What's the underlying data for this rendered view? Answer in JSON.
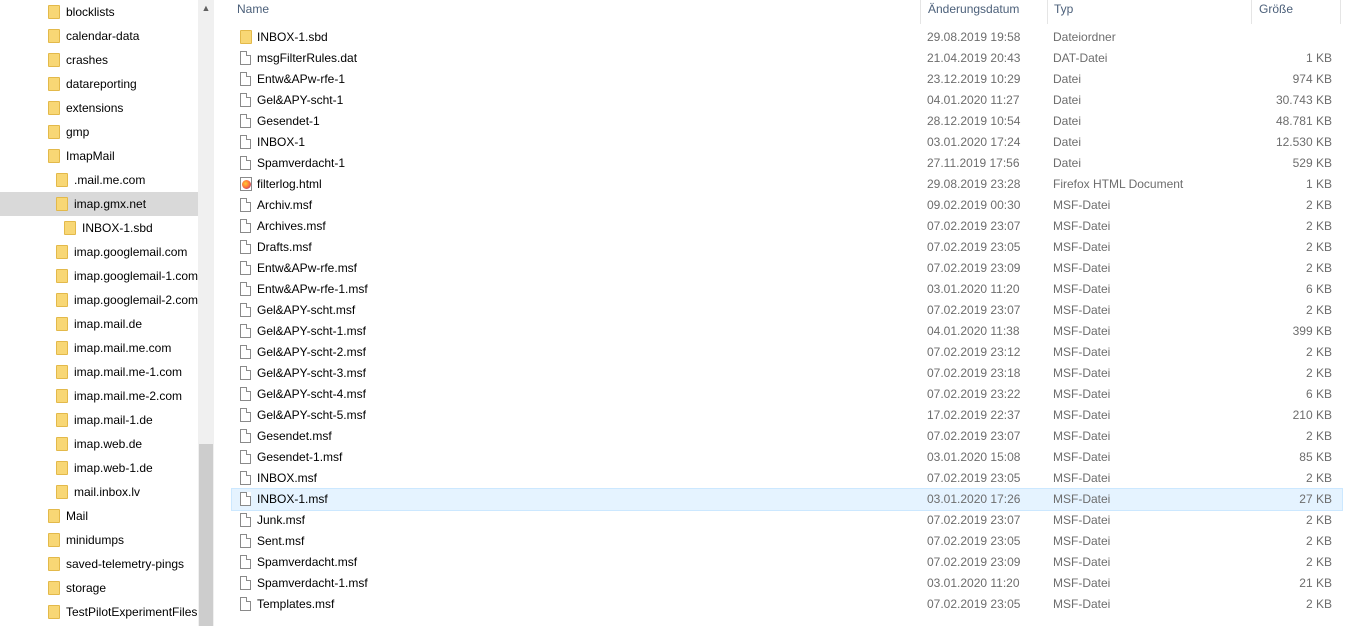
{
  "nav": {
    "items": [
      {
        "label": "blocklists",
        "level": 0
      },
      {
        "label": "calendar-data",
        "level": 0
      },
      {
        "label": "crashes",
        "level": 0
      },
      {
        "label": "datareporting",
        "level": 0
      },
      {
        "label": "extensions",
        "level": 0
      },
      {
        "label": "gmp",
        "level": 0
      },
      {
        "label": "ImapMail",
        "level": 0
      },
      {
        "label": ".mail.me.com",
        "level": 1
      },
      {
        "label": "imap.gmx.net",
        "level": 1,
        "selected": true
      },
      {
        "label": "INBOX-1.sbd",
        "level": 2
      },
      {
        "label": "imap.googlemail.com",
        "level": 1
      },
      {
        "label": "imap.googlemail-1.com",
        "level": 1
      },
      {
        "label": "imap.googlemail-2.com",
        "level": 1
      },
      {
        "label": "imap.mail.de",
        "level": 1
      },
      {
        "label": "imap.mail.me.com",
        "level": 1
      },
      {
        "label": "imap.mail.me-1.com",
        "level": 1
      },
      {
        "label": "imap.mail.me-2.com",
        "level": 1
      },
      {
        "label": "imap.mail-1.de",
        "level": 1
      },
      {
        "label": "imap.web.de",
        "level": 1
      },
      {
        "label": "imap.web-1.de",
        "level": 1
      },
      {
        "label": "mail.inbox.lv",
        "level": 1
      },
      {
        "label": "Mail",
        "level": 0
      },
      {
        "label": "minidumps",
        "level": 0
      },
      {
        "label": "saved-telemetry-pings",
        "level": 0
      },
      {
        "label": "storage",
        "level": 0
      },
      {
        "label": "TestPilotExperimentFiles",
        "level": 0
      }
    ],
    "scroll_up_icon": "chevron-up-icon"
  },
  "list": {
    "columns": {
      "name": "Name",
      "date": "Änderungsdatum",
      "type": "Typ",
      "size": "Größe"
    },
    "rows": [
      {
        "name": "INBOX-1.sbd",
        "date": "29.08.2019 19:58",
        "type": "Dateiordner",
        "size": "",
        "icon": "folder-icon"
      },
      {
        "name": "msgFilterRules.dat",
        "date": "21.04.2019 20:43",
        "type": "DAT-Datei",
        "size": "1 KB",
        "icon": "file-icon"
      },
      {
        "name": "Entw&APw-rfe-1",
        "date": "23.12.2019 10:29",
        "type": "Datei",
        "size": "974 KB",
        "icon": "file-icon"
      },
      {
        "name": "Gel&APY-scht-1",
        "date": "04.01.2020 11:27",
        "type": "Datei",
        "size": "30.743 KB",
        "icon": "file-icon"
      },
      {
        "name": "Gesendet-1",
        "date": "28.12.2019 10:54",
        "type": "Datei",
        "size": "48.781 KB",
        "icon": "file-icon"
      },
      {
        "name": "INBOX-1",
        "date": "03.01.2020 17:24",
        "type": "Datei",
        "size": "12.530 KB",
        "icon": "file-icon"
      },
      {
        "name": "Spamverdacht-1",
        "date": "27.11.2019 17:56",
        "type": "Datei",
        "size": "529 KB",
        "icon": "file-icon"
      },
      {
        "name": "filterlog.html",
        "date": "29.08.2019 23:28",
        "type": "Firefox HTML Document",
        "size": "1 KB",
        "icon": "firefox-html-icon"
      },
      {
        "name": "Archiv.msf",
        "date": "09.02.2019 00:30",
        "type": "MSF-Datei",
        "size": "2 KB",
        "icon": "file-icon"
      },
      {
        "name": "Archives.msf",
        "date": "07.02.2019 23:07",
        "type": "MSF-Datei",
        "size": "2 KB",
        "icon": "file-icon"
      },
      {
        "name": "Drafts.msf",
        "date": "07.02.2019 23:05",
        "type": "MSF-Datei",
        "size": "2 KB",
        "icon": "file-icon"
      },
      {
        "name": "Entw&APw-rfe.msf",
        "date": "07.02.2019 23:09",
        "type": "MSF-Datei",
        "size": "2 KB",
        "icon": "file-icon"
      },
      {
        "name": "Entw&APw-rfe-1.msf",
        "date": "03.01.2020 11:20",
        "type": "MSF-Datei",
        "size": "6 KB",
        "icon": "file-icon"
      },
      {
        "name": "Gel&APY-scht.msf",
        "date": "07.02.2019 23:07",
        "type": "MSF-Datei",
        "size": "2 KB",
        "icon": "file-icon"
      },
      {
        "name": "Gel&APY-scht-1.msf",
        "date": "04.01.2020 11:38",
        "type": "MSF-Datei",
        "size": "399 KB",
        "icon": "file-icon"
      },
      {
        "name": "Gel&APY-scht-2.msf",
        "date": "07.02.2019 23:12",
        "type": "MSF-Datei",
        "size": "2 KB",
        "icon": "file-icon"
      },
      {
        "name": "Gel&APY-scht-3.msf",
        "date": "07.02.2019 23:18",
        "type": "MSF-Datei",
        "size": "2 KB",
        "icon": "file-icon"
      },
      {
        "name": "Gel&APY-scht-4.msf",
        "date": "07.02.2019 23:22",
        "type": "MSF-Datei",
        "size": "6 KB",
        "icon": "file-icon"
      },
      {
        "name": "Gel&APY-scht-5.msf",
        "date": "17.02.2019 22:37",
        "type": "MSF-Datei",
        "size": "210 KB",
        "icon": "file-icon"
      },
      {
        "name": "Gesendet.msf",
        "date": "07.02.2019 23:07",
        "type": "MSF-Datei",
        "size": "2 KB",
        "icon": "file-icon"
      },
      {
        "name": "Gesendet-1.msf",
        "date": "03.01.2020 15:08",
        "type": "MSF-Datei",
        "size": "85 KB",
        "icon": "file-icon"
      },
      {
        "name": "INBOX.msf",
        "date": "07.02.2019 23:05",
        "type": "MSF-Datei",
        "size": "2 KB",
        "icon": "file-icon"
      },
      {
        "name": "INBOX-1.msf",
        "date": "03.01.2020 17:26",
        "type": "MSF-Datei",
        "size": "27 KB",
        "icon": "file-icon",
        "highlighted": true
      },
      {
        "name": "Junk.msf",
        "date": "07.02.2019 23:07",
        "type": "MSF-Datei",
        "size": "2 KB",
        "icon": "file-icon"
      },
      {
        "name": "Sent.msf",
        "date": "07.02.2019 23:05",
        "type": "MSF-Datei",
        "size": "2 KB",
        "icon": "file-icon"
      },
      {
        "name": "Spamverdacht.msf",
        "date": "07.02.2019 23:09",
        "type": "MSF-Datei",
        "size": "2 KB",
        "icon": "file-icon"
      },
      {
        "name": "Spamverdacht-1.msf",
        "date": "03.01.2020 11:20",
        "type": "MSF-Datei",
        "size": "21 KB",
        "icon": "file-icon"
      },
      {
        "name": "Templates.msf",
        "date": "07.02.2019 23:05",
        "type": "MSF-Datei",
        "size": "2 KB",
        "icon": "file-icon"
      }
    ]
  },
  "colors": {
    "selected_nav_bg": "#d9d9d9",
    "hover_row_bg": "#e5f3ff",
    "header_text": "#4c607a",
    "folder_yellow": "#f8d775"
  }
}
